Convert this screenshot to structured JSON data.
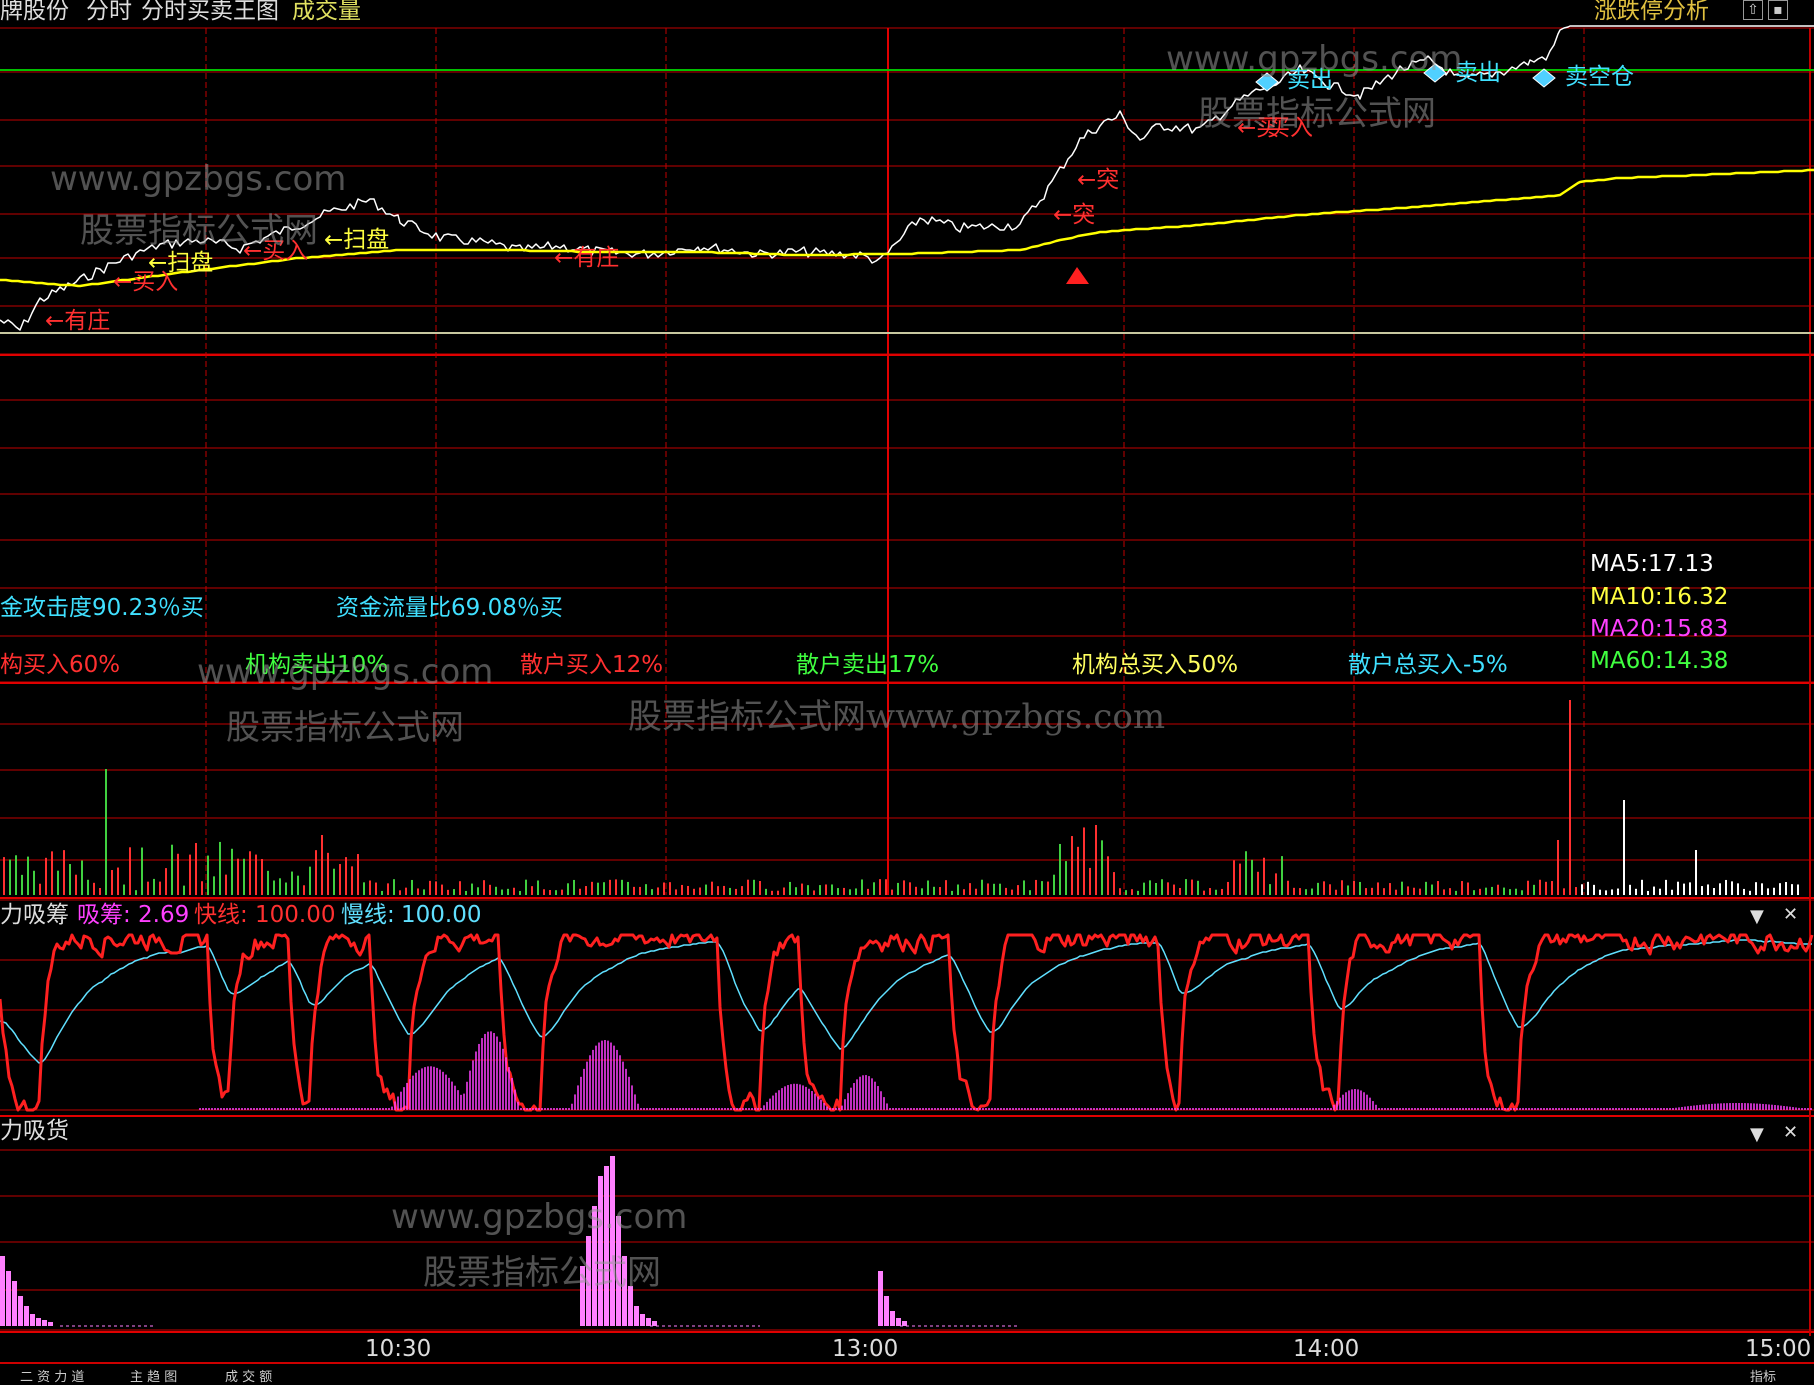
{
  "header": {
    "stock_name": "牌股份",
    "mode": "分时",
    "indicator_name": "分时买卖王图",
    "volume_label": "成交量",
    "limit_analysis": "涨跌停分析"
  },
  "price_signals": {
    "labels": [
      {
        "text": "←有庄",
        "color": "#ff3030"
      },
      {
        "text": "←买入",
        "color": "#ff3030"
      },
      {
        "text": "←扫盘",
        "color": "#ffff40"
      },
      {
        "text": "←买入",
        "color": "#ff3030"
      },
      {
        "text": "←扫盘",
        "color": "#ffff40"
      },
      {
        "text": "←有庄",
        "color": "#ff3030"
      },
      {
        "text": "←买",
        "color": "#ff3030"
      },
      {
        "text": "←突",
        "color": "#ff3030"
      },
      {
        "text": "←突",
        "color": "#ff3030"
      },
      {
        "text": "买入",
        "color": "#ff3030"
      },
      {
        "text": "卖出",
        "color": "#40e0ff"
      },
      {
        "text": "卖出",
        "color": "#40e0ff"
      },
      {
        "text": "卖空仓",
        "color": "#40e0ff"
      }
    ]
  },
  "info": {
    "attack": "金攻击度90.23％买",
    "flow_ratio": "资金流量比69.08％买",
    "inst_buy": "构买入60%",
    "inst_sell": "机构卖出10%",
    "retail_buy": "散户买入12%",
    "retail_sell": "散户卖出17%",
    "inst_total": "机构总买入50%",
    "retail_total": "散户总买入-5%"
  },
  "ma": {
    "ma5": "MA5:17.13",
    "ma10": "MA10:16.32",
    "ma20": "MA20:15.83",
    "ma60": "MA60:14.38"
  },
  "panel1": {
    "title": "力吸筹",
    "x_label": "吸筹:",
    "x_value": "2.69",
    "fast_label": "快线:",
    "fast_value": "100.00",
    "slow_label": "慢线:",
    "slow_value": "100.00"
  },
  "panel2": {
    "title": "力吸货"
  },
  "time_axis": [
    "10:30",
    "13:00",
    "14:00",
    "15:00"
  ],
  "watermarks": {
    "url": "www.gpzbgs.com",
    "site": "股票指标公式网",
    "combined": "股票指标公式网www.gpzbgs.com"
  },
  "bottom_tabs": [
    "二 资 力 道",
    "主 趋 图",
    "成 交 额",
    "指标"
  ],
  "colors": {
    "grid": "#c00000",
    "price": "#ffffff",
    "avg": "#ffff00",
    "fast": "#ff2020",
    "slow": "#60e0ff",
    "absorb": "#ff40ff",
    "green_line": "#00c000"
  }
}
